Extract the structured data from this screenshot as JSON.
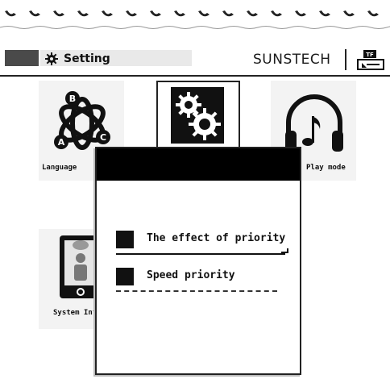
{
  "header": {
    "title": "Setting",
    "brand": "SUNSTECH",
    "storage_badge": "TF"
  },
  "menu": {
    "items": [
      {
        "label": "Language",
        "icon": "language-abc-icon"
      },
      {
        "label": "",
        "icon": "settings-gears-icon"
      },
      {
        "label": "Play mode",
        "icon": "headphones-music-icon"
      },
      {
        "label": "System Info",
        "icon": "system-info-icon"
      }
    ]
  },
  "dialog": {
    "title": "",
    "options": [
      {
        "label": "The effect of priority",
        "selected": true
      },
      {
        "label": "Speed priority",
        "selected": false
      }
    ]
  }
}
